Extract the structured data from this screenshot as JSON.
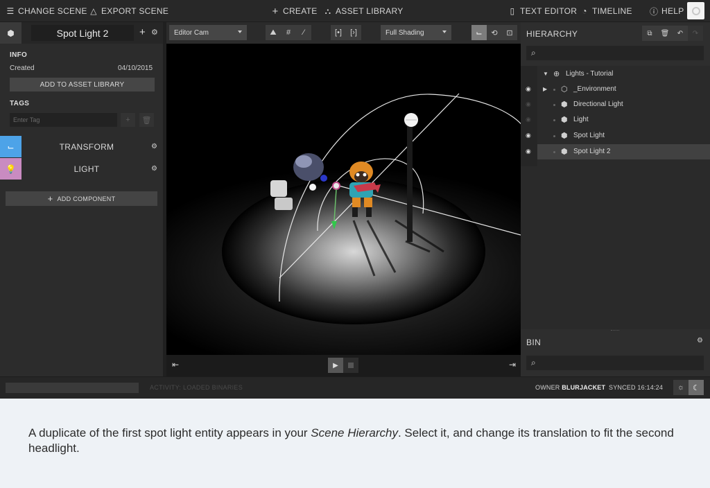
{
  "topbar": {
    "change_scene": "CHANGE SCENE",
    "export_scene": "EXPORT SCENE",
    "create": "CREATE",
    "asset_library": "ASSET LIBRARY",
    "text_editor": "TEXT EDITOR",
    "timeline": "TIMELINE",
    "help": "HELP"
  },
  "entity": {
    "name": "Spot Light 2",
    "info_title": "INFO",
    "created_label": "Created",
    "created_value": "04/10/2015",
    "add_to_asset_library": "ADD TO ASSET LIBRARY",
    "tags_title": "TAGS",
    "tag_placeholder": "Enter Tag",
    "components": [
      {
        "label": "TRANSFORM",
        "color": "#4da3e8",
        "icon": "transform-axis-icon"
      },
      {
        "label": "LIGHT",
        "color": "#c98bc1",
        "icon": "bulb-icon"
      }
    ],
    "add_component": "ADD COMPONENT"
  },
  "viewport": {
    "camera": "Editor Cam",
    "shading": "Full Shading"
  },
  "hierarchy": {
    "title": "HIERARCHY",
    "items": [
      {
        "label": "Lights - Tutorial",
        "icon": "globe-icon",
        "depth": 0,
        "expanded": true
      },
      {
        "label": "_Environment",
        "icon": "hexagon-icon",
        "depth": 1,
        "visible": true,
        "collapsed": true
      },
      {
        "label": "Directional Light",
        "icon": "light-entity-icon",
        "depth": 1,
        "visible": false
      },
      {
        "label": "Light",
        "icon": "light-entity-icon",
        "depth": 1,
        "visible": false
      },
      {
        "label": "Spot Light",
        "icon": "light-entity-icon",
        "depth": 1,
        "visible": true
      },
      {
        "label": "Spot Light 2",
        "icon": "light-entity-icon",
        "depth": 1,
        "visible": true,
        "selected": true
      }
    ]
  },
  "bin": {
    "title": "BIN"
  },
  "status": {
    "activity": "ACTIVITY: LOADED BINARIES",
    "owner_label": "OWNER",
    "owner_name": "BLURJACKET",
    "synced_label": "SYNCED",
    "synced_time": "16:14:24"
  },
  "caption": {
    "part1": "A duplicate of the first spot light entity appears in your ",
    "emph": "Scene Hierarchy",
    "part2": ". Select it, and change its translation to fit the second headlight."
  }
}
